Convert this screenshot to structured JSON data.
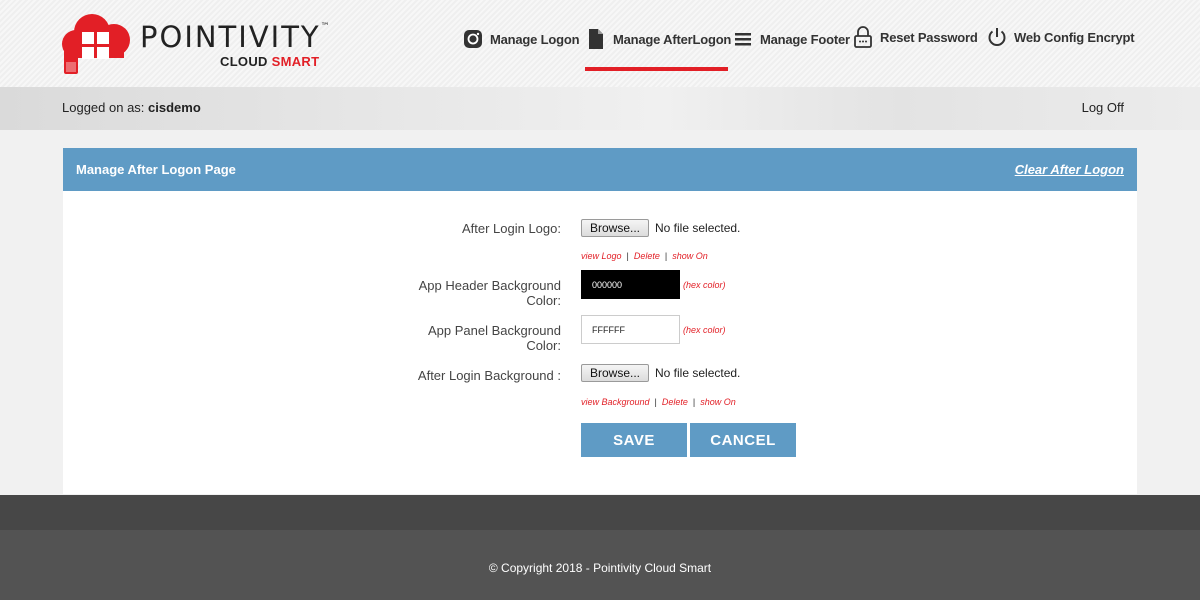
{
  "brand": {
    "name": "POINTIVITY",
    "tm": "™",
    "tagline_a": "CLOUD",
    "tagline_b": "SMART",
    "accent_color": "#e21f26"
  },
  "nav": {
    "items": [
      {
        "label": "Manage Logon",
        "icon": "camera-icon"
      },
      {
        "label": "Manage AfterLogon",
        "icon": "document-icon",
        "active": true
      },
      {
        "label": "Manage Footer",
        "icon": "menu-icon"
      },
      {
        "label": "Reset Password",
        "icon": "lock-icon"
      },
      {
        "label": "Web Config Encrypt",
        "icon": "power-icon"
      }
    ]
  },
  "userbar": {
    "prefix": "Logged on as:",
    "user": "cisdemo",
    "logoff": "Log Off"
  },
  "panel": {
    "title": "Manage After Logon Page",
    "clear_link": "Clear After Logon",
    "header_color": "#5f9bc5",
    "fields": {
      "logo": {
        "label": "After Login Logo:",
        "browse": "Browse...",
        "nofile": "No file selected.",
        "links": [
          "view Logo",
          "Delete",
          "show On"
        ]
      },
      "header_bg": {
        "label_line1": "App Header Background",
        "label_line2": "Color:",
        "value": "000000",
        "hint": "(hex color)"
      },
      "panel_bg": {
        "label_line1": "App Panel Background",
        "label_line2": "Color:",
        "value": "FFFFFF",
        "hint": "(hex color)"
      },
      "background": {
        "label": "After Login Background :",
        "browse": "Browse...",
        "nofile": "No file selected.",
        "links": [
          "view Background",
          "Delete",
          "show On"
        ]
      }
    },
    "save": "SAVE",
    "cancel": "CANCEL"
  },
  "footer": {
    "copyright": "© Copyright 2018 - Pointivity Cloud Smart"
  }
}
